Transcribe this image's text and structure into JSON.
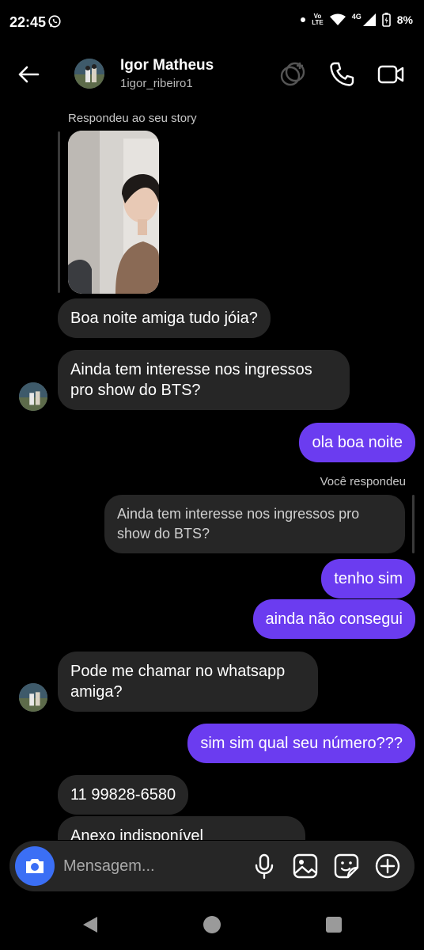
{
  "status_bar": {
    "time": "22:45",
    "volte_top": "Vo",
    "volte_bottom": "LTE",
    "network": "4G",
    "battery": "8%"
  },
  "header": {
    "name": "Igor Matheus",
    "username": "1igor_ribeiro1"
  },
  "messages": {
    "story_caption": "Respondeu ao seu story",
    "msg1": "Boa noite amiga tudo jóia?",
    "msg2": "Ainda tem interesse nos ingressos pro show do BTS?",
    "msg3": "ola boa noite",
    "reply_caption": "Você respondeu",
    "quoted": "Ainda tem interesse nos ingressos pro show do BTS?",
    "msg4": "tenho sim",
    "msg5": "ainda não consegui",
    "msg6": "Pode me chamar no whatsapp amiga?",
    "msg7": "sim sim qual seu número???",
    "msg8": "11 99828-6580",
    "msg9": "Anexo indisponível"
  },
  "composer": {
    "placeholder": "Mensagem..."
  },
  "colors": {
    "outgoing_bubble": "#6b3cf0",
    "incoming_bubble": "#262626",
    "camera_button": "#3b6ff5"
  },
  "icons": [
    "whatsapp-icon",
    "dot-icon",
    "wifi-icon",
    "signal-icon",
    "battery-icon",
    "back-arrow-icon",
    "effects-icon",
    "phone-icon",
    "video-icon",
    "camera-icon",
    "microphone-icon",
    "gallery-icon",
    "sticker-icon",
    "plus-icon",
    "nav-back-icon",
    "nav-home-icon",
    "nav-recents-icon"
  ]
}
